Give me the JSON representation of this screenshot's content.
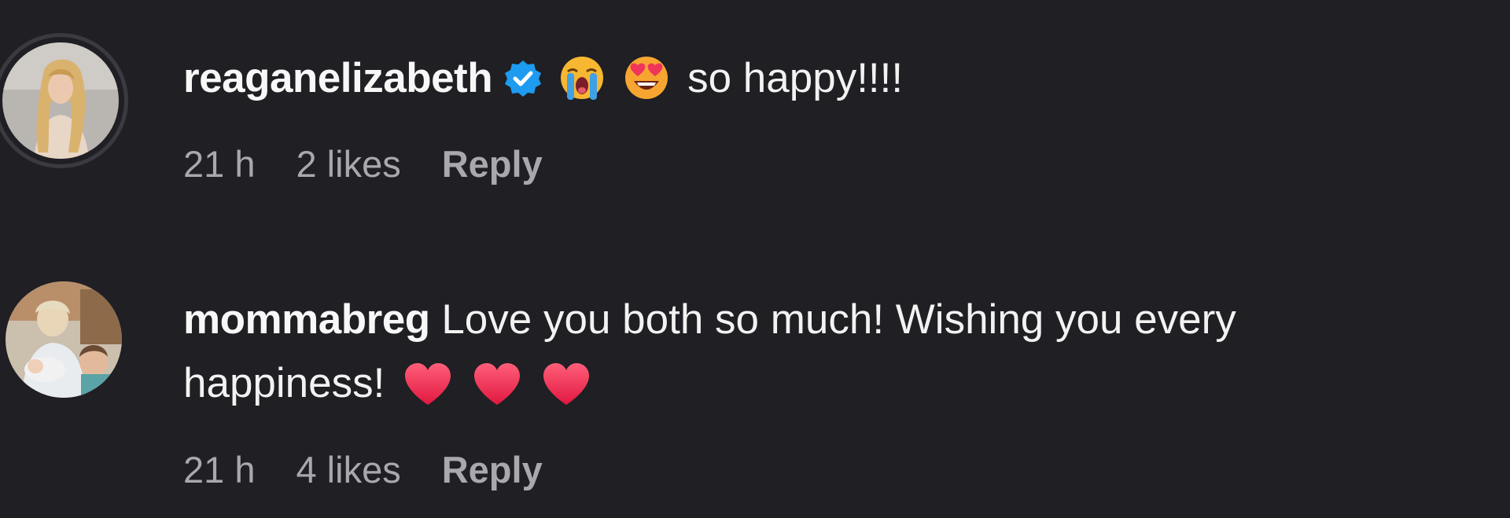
{
  "comments": [
    {
      "username": "reaganelizabeth",
      "verified": true,
      "emojis": [
        "loudly-crying-face",
        "smiling-face-with-heart-eyes"
      ],
      "text": "so happy!!!!",
      "time": "21 h",
      "likes": "2 likes",
      "reply_label": "Reply"
    },
    {
      "username": "mommabreg",
      "verified": false,
      "text_line1": "Love you both so much! Wishing you every",
      "text_line2": "happiness!",
      "emojis": [
        "red-heart",
        "red-heart",
        "red-heart"
      ],
      "time": "21 h",
      "likes": "4 likes",
      "reply_label": "Reply"
    }
  ],
  "colors": {
    "background": "#1f1f24",
    "text": "#f2f2f2",
    "meta": "#a8a8ad",
    "verified_badge": "#1d9bf0",
    "heart": "#f23a5c"
  }
}
